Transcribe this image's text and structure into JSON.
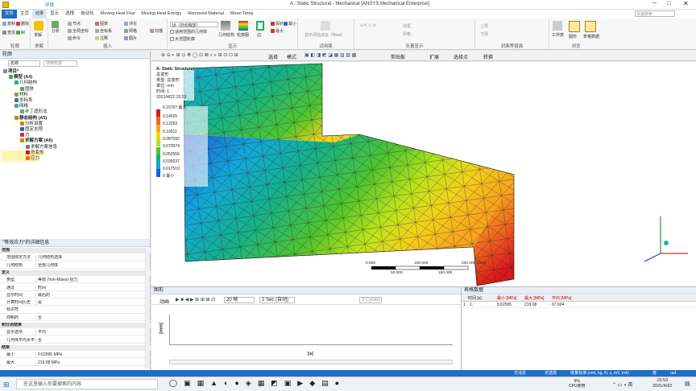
{
  "window": {
    "title": "A : Static Structural - Mechanical [ANSYS Mechanical Enterprise]",
    "context_tab": "环境"
  },
  "menu_tabs": [
    "文件",
    "主页",
    "结果",
    "显示",
    "选择",
    "自动化",
    "Moving Heat Flux",
    "Moving Heat Energy",
    "Removed Material",
    "Mean Temp"
  ],
  "ribbon": {
    "groups": [
      {
        "label": "轮廓",
        "items": [
          "复制",
          "删除",
          "查找",
          "树"
        ]
      },
      {
        "label": "求解",
        "items": [
          "求解"
        ]
      },
      {
        "label": "插入",
        "items": [
          "分析",
          "节点",
          "全局坐标",
          "命令",
          "图表",
          "坐标系",
          "注释",
          "评论",
          "网格",
          "图片",
          "扫描"
        ]
      },
      {
        "label": "显示",
        "items": [
          "18（自动缩放）",
          "适用范围的几何体",
          "大范围轮廓",
          "几何结构",
          "轮廓图",
          "边",
          "探针",
          "最小",
          "最大"
        ]
      },
      {
        "label": "试用版",
        "items": [
          "显示评估点云（Beta）"
        ]
      },
      {
        "label": "矢量显示",
        "items": [
          "线框",
          "网格"
        ]
      },
      {
        "label": "封面等值面",
        "items": [
          "上限",
          "下限"
        ]
      },
      {
        "label": "浏览",
        "items": [
          "工作表",
          "图形",
          "表格数据"
        ]
      }
    ],
    "search_placeholder": "快速搜索"
  },
  "graphics_toolbar": {
    "items": [
      "选择",
      "模式",
      "剪贴板",
      "扩展",
      "选择点",
      "转换"
    ]
  },
  "outline": {
    "title": "轮廓",
    "name_label": "名称",
    "search_placeholder": "搜索概要",
    "tree": [
      {
        "label": "项目*",
        "depth": 0,
        "icon": "project-icon"
      },
      {
        "label": "模型 (A4)",
        "depth": 1,
        "icon": "model-icon"
      },
      {
        "label": "几何结构",
        "depth": 2,
        "icon": "geometry-icon"
      },
      {
        "label": "固体",
        "depth": 3,
        "icon": "solid-icon"
      },
      {
        "label": "材料",
        "depth": 2,
        "icon": "material-icon"
      },
      {
        "label": "坐标系",
        "depth": 2,
        "icon": "coordinate-icon"
      },
      {
        "label": "网格",
        "depth": 2,
        "icon": "mesh-icon"
      },
      {
        "label": "补丁适形法",
        "depth": 3,
        "icon": "patch-icon"
      },
      {
        "label": "静态结构 (A5)",
        "depth": 2,
        "icon": "static-icon"
      },
      {
        "label": "分析设置",
        "depth": 3,
        "icon": "settings-icon"
      },
      {
        "label": "固定支撑",
        "depth": 3,
        "icon": "support-icon"
      },
      {
        "label": "力",
        "depth": 3,
        "icon": "force-icon"
      },
      {
        "label": "求解方案 (A6)",
        "depth": 3,
        "icon": "solution-icon"
      },
      {
        "label": "求解方案信息",
        "depth": 4,
        "icon": "info-icon"
      },
      {
        "label": "总变形",
        "depth": 4,
        "icon": "deformation-icon"
      },
      {
        "label": "应力",
        "depth": 4,
        "icon": "stress-icon"
      }
    ]
  },
  "details": {
    "title": "\"等效应力\"的详细信息",
    "rows": [
      {
        "section": "范围"
      },
      {
        "k": "范围限定方法",
        "v": "几何结构选择"
      },
      {
        "k": "几何结构",
        "v": "全部几何体"
      },
      {
        "section": "定义"
      },
      {
        "k": "类型",
        "v": "等效 (Von-Mises) 应力"
      },
      {
        "k": "通过",
        "v": "时间"
      },
      {
        "k": "显示时间",
        "v": "最后的"
      },
      {
        "k": "计算时间历史",
        "v": "是"
      },
      {
        "k": "标识符",
        "v": ""
      },
      {
        "k": "抑制的",
        "v": "否"
      },
      {
        "section": "积分点结果"
      },
      {
        "k": "显示选项",
        "v": "平均"
      },
      {
        "k": "几何体平均水平",
        "v": "否"
      },
      {
        "section": "结果"
      },
      {
        "k": "最小",
        "v": "0.62595 MPa"
      },
      {
        "k": "最大",
        "v": "219.08 MPa"
      }
    ]
  },
  "viewport": {
    "info": [
      "A: Static Structural",
      "总变形",
      "类型: 总变形",
      "单位: mm",
      "时间: 1",
      "2021/4/22 15:53"
    ],
    "legend_title": "0.15767 最大",
    "legend_values": [
      "0.14015",
      "0.12263",
      "0.10511",
      "0.087592",
      "0.070074",
      "0.052556",
      "0.035037",
      "0.017519",
      "0 最小"
    ],
    "legend_colors": [
      "#d7191c",
      "#f0661f",
      "#f7a51e",
      "#f2d21a",
      "#b9e31d",
      "#4fc52e",
      "#16b08a",
      "#13a8d8",
      "#1e5bd6"
    ],
    "scale_labels": [
      "0.000",
      "100.000",
      "200.000 (mm)",
      "50.000",
      "150.000"
    ]
  },
  "graph": {
    "title": "图形",
    "animation_label": "动画",
    "frames": "20 帧",
    "duration": "2 Sec (自动)",
    "cycles": "3 Cycles",
    "ylabel": "[mm]",
    "xlabel": "[s]"
  },
  "table": {
    "title": "表格数据",
    "headers": [
      "时间 [s]",
      "最小 [MPa]",
      "最大 [MPa]",
      "平均 [MPa]"
    ],
    "rows": [
      [
        "1",
        "1.",
        "0.62595",
        "219.08",
        "67.604"
      ]
    ]
  },
  "status": {
    "messages": "无消息",
    "selection": "无选择",
    "units": "度量标准 (mm, kg, N, s, mV, mA)",
    "angle": "度",
    "angular_velocity": "rad"
  },
  "taskbar": {
    "search_placeholder": "在这里输入你要搜索的内容",
    "cpu": "6%",
    "cpu_label": "CPU使用",
    "time": "15:53",
    "date": "2021/4/22"
  }
}
